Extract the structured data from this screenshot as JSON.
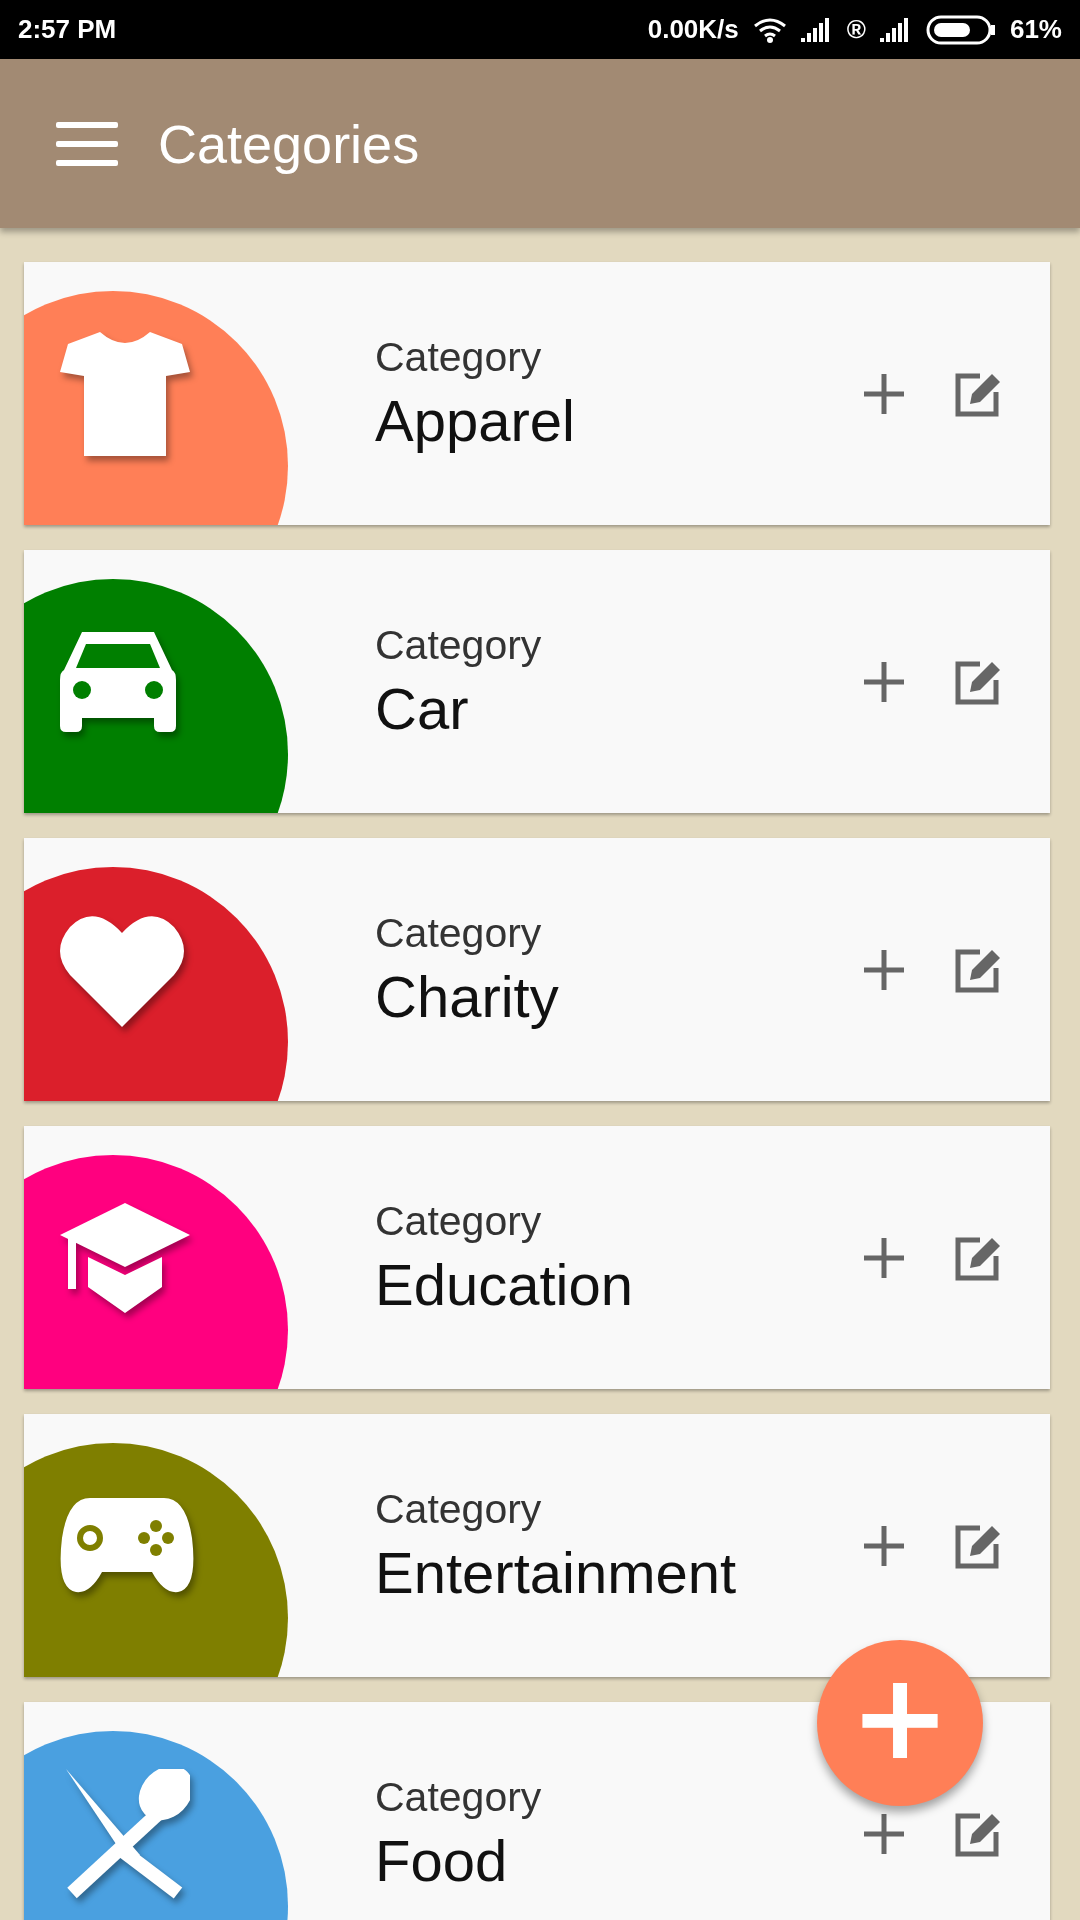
{
  "status_bar": {
    "time": "2:57 PM",
    "speed": "0.00K/s",
    "roaming": "®",
    "battery": "61%"
  },
  "app_bar": {
    "title": "Categories"
  },
  "categories": [
    {
      "caption": "Category",
      "name": "Apparel",
      "color": "#ff7f57"
    },
    {
      "caption": "Category",
      "name": "Car",
      "color": "#007f00"
    },
    {
      "caption": "Category",
      "name": "Charity",
      "color": "#db1f2b"
    },
    {
      "caption": "Category",
      "name": "Education",
      "color": "#ff007f"
    },
    {
      "caption": "Category",
      "name": "Entertainment",
      "color": "#7f7f00"
    },
    {
      "caption": "Category",
      "name": "Food",
      "color": "#4aa0e0"
    }
  ],
  "fab": {
    "label": "+"
  }
}
